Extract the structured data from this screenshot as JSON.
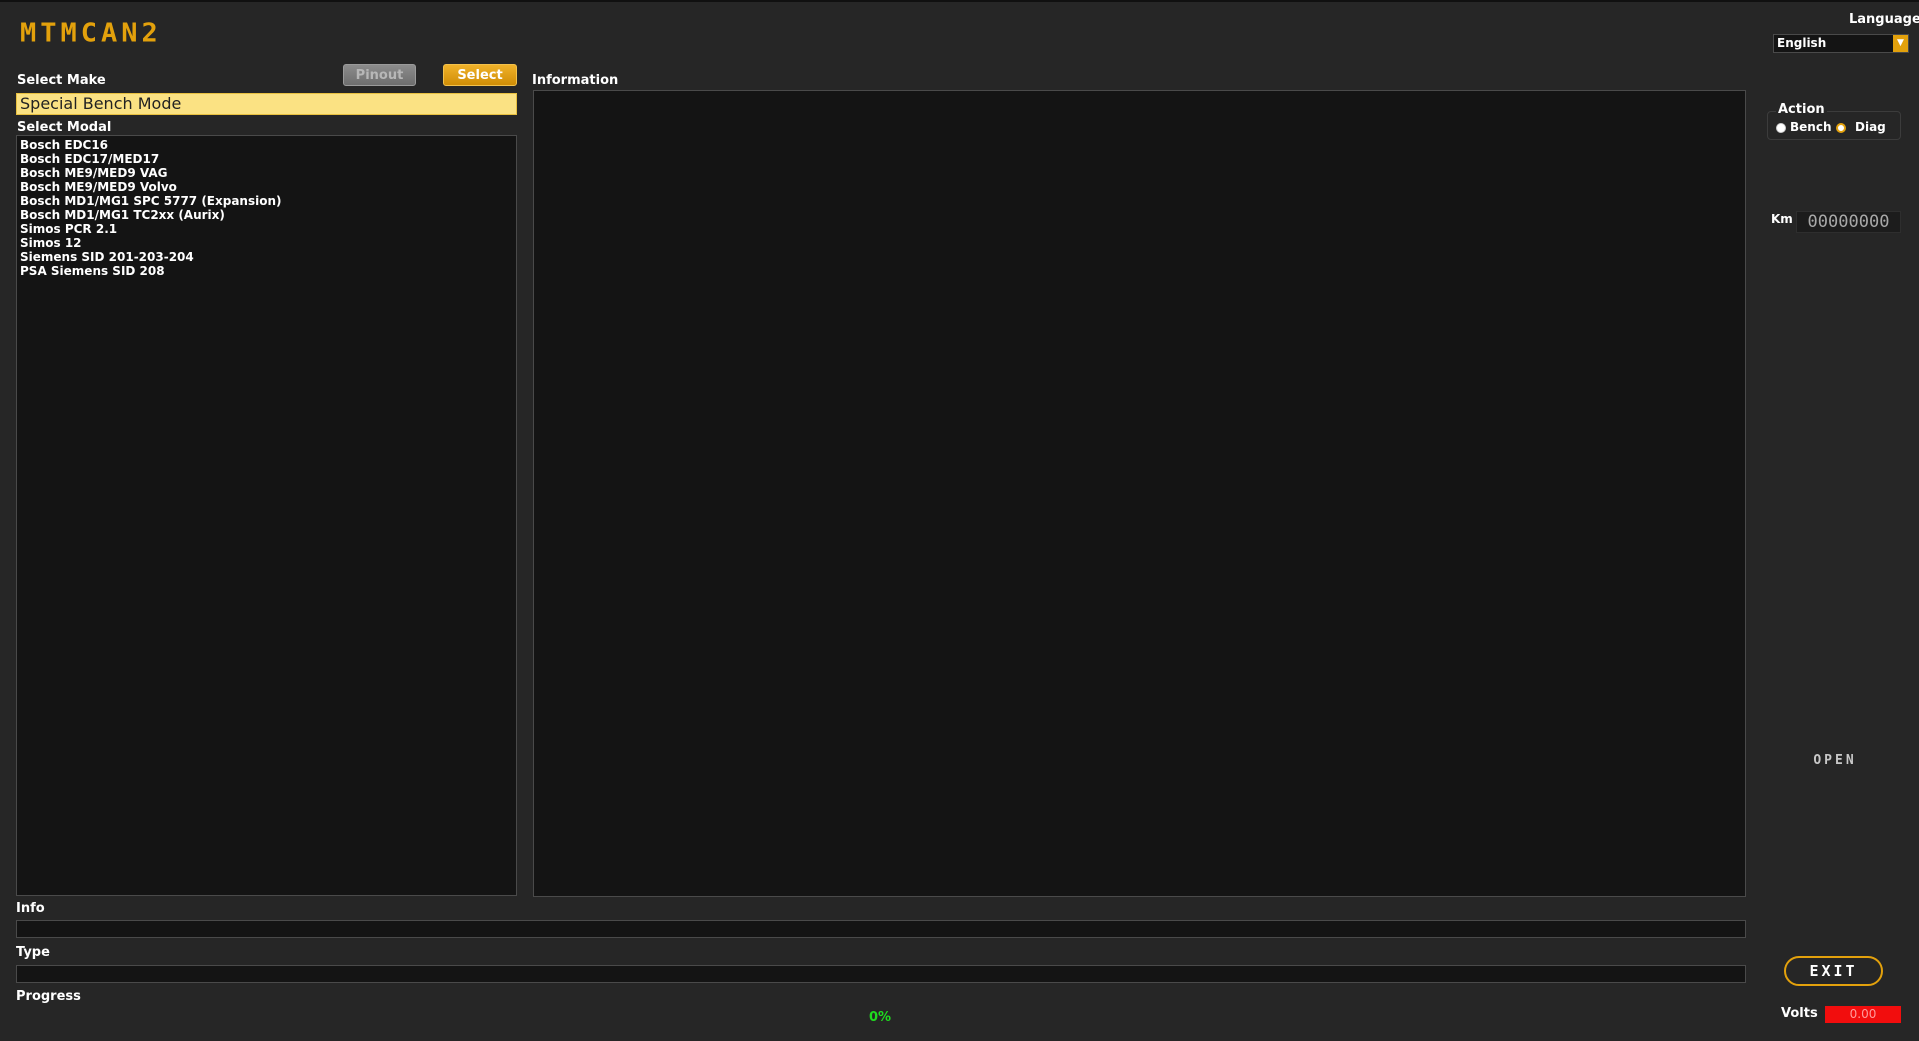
{
  "app": {
    "logo_text": "MTMCAN2"
  },
  "make": {
    "label": "Select Make",
    "value": "Special Bench Mode"
  },
  "buttons": {
    "pinout": "Pinout",
    "select": "Select",
    "open": "OPEN",
    "exit": "EXIT"
  },
  "model": {
    "label": "Select Modal",
    "items": [
      "Bosch EDC16",
      "Bosch EDC17/MED17",
      "Bosch ME9/MED9 VAG",
      "Bosch ME9/MED9 Volvo",
      "Bosch MD1/MG1 SPC 5777 (Expansion)",
      "Bosch MD1/MG1 TC2xx (Aurix)",
      "Simos PCR 2.1",
      "Simos 12",
      "Siemens SID 201-203-204",
      "PSA Siemens SID 208"
    ]
  },
  "information": {
    "label": "Information"
  },
  "info": {
    "label": "Info"
  },
  "type": {
    "label": "Type"
  },
  "progress": {
    "label": "Progress",
    "text": "0%",
    "fraction": 0
  },
  "language": {
    "label": "Language",
    "selected": "English"
  },
  "action": {
    "label": "Action",
    "options": [
      "Bench",
      "Diag"
    ],
    "selected": "Diag"
  },
  "km": {
    "label": "Km",
    "value": "00000000"
  },
  "volts": {
    "label": "Volts",
    "value": "0.00"
  },
  "colors": {
    "accent": "#e3a10c",
    "background": "#262626",
    "panel": "#141414",
    "make_field": "#fbe283",
    "progress_text": "#1fdc1f",
    "volts_bg": "#f20d0d"
  },
  "icons": {
    "language_dropdown": "chevron-down-icon"
  }
}
